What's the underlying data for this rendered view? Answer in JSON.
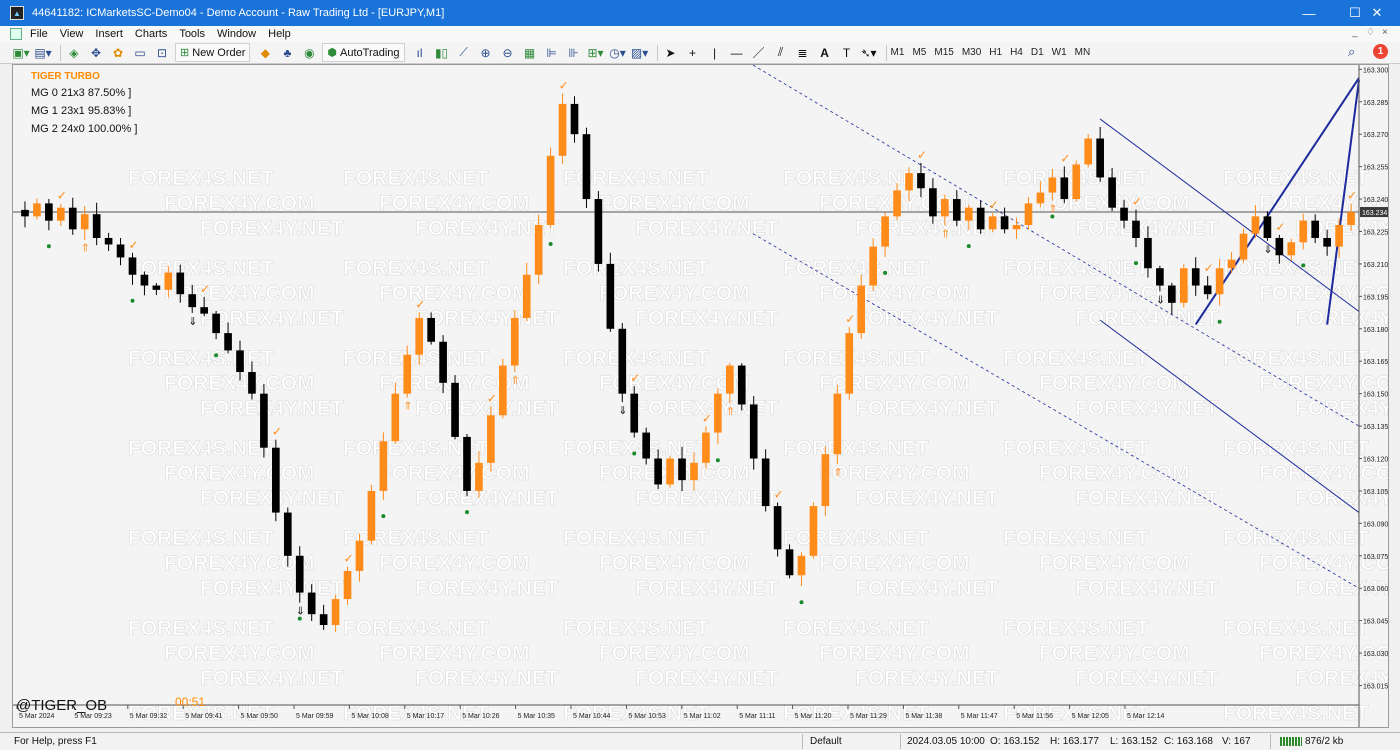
{
  "window": {
    "title": "44641182: ICMarketsSC-Demo04 - Demo Account - Raw Trading Ltd - [EURJPY,M1]",
    "controls": [
      "—",
      "☐",
      "✕"
    ]
  },
  "menu": {
    "items": [
      "File",
      "View",
      "Insert",
      "Charts",
      "Tools",
      "Window",
      "Help"
    ],
    "mdi_controls": [
      "_",
      "♢",
      "×"
    ]
  },
  "toolbar": {
    "new_order_label": "New Order",
    "autotrading_label": "AutoTrading",
    "timeframes": [
      "M1",
      "M5",
      "M15",
      "M30",
      "H1",
      "H4",
      "D1",
      "W1",
      "MN"
    ],
    "text_tool_label": "A",
    "notification_count": "1"
  },
  "indicator": {
    "title": "TIGER TURBO",
    "lines": [
      "MG 0  21x3  87.50%  ]",
      "MG 1  23x1  95.83%  ]",
      "MG 2  24x0  100.00%  ]"
    ]
  },
  "overlay": {
    "signature": "@TIGER_OB",
    "countdown": "00:51"
  },
  "chart_data": {
    "type": "candlestick",
    "symbol": "EURJPY",
    "timeframe": "M1",
    "current_price": "163.234",
    "ylim": [
      163.006,
      163.302
    ],
    "y_ticks": [
      "163.300",
      "163.285",
      "163.270",
      "163.255",
      "163.240",
      "163.225",
      "163.210",
      "163.195",
      "163.180",
      "163.165",
      "163.150",
      "163.135",
      "163.120",
      "163.105",
      "163.090",
      "163.075",
      "163.060",
      "163.045",
      "163.030",
      "163.015"
    ],
    "x_ticks": [
      "5 Mar 2024",
      "5 Mar 09:23",
      "5 Mar 09:32",
      "5 Mar 09:41",
      "5 Mar 09:50",
      "5 Mar 09:59",
      "5 Mar 10:08",
      "5 Mar 10:17",
      "5 Mar 10:26",
      "5 Mar 10:35",
      "5 Mar 10:44",
      "5 Mar 10:53",
      "5 Mar 11:02",
      "5 Mar 11:11",
      "5 Mar 11:20",
      "5 Mar 11:29",
      "5 Mar 11:38",
      "5 Mar 11:47",
      "5 Mar 11:56",
      "5 Mar 12:05",
      "5 Mar 12:14"
    ],
    "bull_color": "#ff8c1a",
    "bear_color": "#000000",
    "watermarks": [
      "FOREX4S.NET",
      "FOREX4Y.COM",
      "FOREX4Y.NET"
    ],
    "close_path": [
      163.232,
      163.238,
      163.23,
      163.236,
      163.226,
      163.233,
      163.222,
      163.219,
      163.213,
      163.205,
      163.2,
      163.198,
      163.206,
      163.196,
      163.19,
      163.187,
      163.178,
      163.17,
      163.16,
      163.15,
      163.125,
      163.095,
      163.075,
      163.058,
      163.048,
      163.043,
      163.055,
      163.068,
      163.082,
      163.105,
      163.128,
      163.15,
      163.168,
      163.185,
      163.174,
      163.155,
      163.13,
      163.105,
      163.118,
      163.14,
      163.163,
      163.185,
      163.205,
      163.228,
      163.26,
      163.284,
      163.27,
      163.24,
      163.21,
      163.18,
      163.15,
      163.132,
      163.12,
      163.108,
      163.12,
      163.11,
      163.118,
      163.132,
      163.15,
      163.163,
      163.145,
      163.12,
      163.098,
      163.078,
      163.066,
      163.075,
      163.098,
      163.122,
      163.15,
      163.178,
      163.2,
      163.218,
      163.232,
      163.244,
      163.252,
      163.245,
      163.232,
      163.24,
      163.23,
      163.236,
      163.226,
      163.232,
      163.226,
      163.228,
      163.238,
      163.243,
      163.25,
      163.24,
      163.256,
      163.268,
      163.25,
      163.236,
      163.23,
      163.222,
      163.208,
      163.2,
      163.192,
      163.208,
      163.2,
      163.196,
      163.208,
      163.212,
      163.224,
      163.232,
      163.222,
      163.214,
      163.22,
      163.23,
      163.222,
      163.218,
      163.228,
      163.234
    ]
  },
  "status": {
    "help": "For Help, press F1",
    "profile": "Default",
    "datetime": "2024.03.05 10:00",
    "open": "O: 163.152",
    "high": "H: 163.177",
    "low": "L: 163.152",
    "close": "C: 163.168",
    "volume": "V: 167",
    "traffic": "876/2 kb"
  }
}
